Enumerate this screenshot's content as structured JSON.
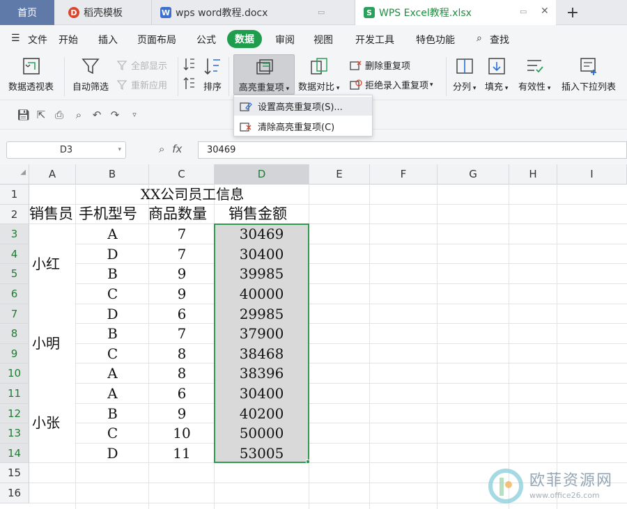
{
  "tabs": [
    {
      "label": "首页"
    },
    {
      "label": "稻壳模板"
    },
    {
      "label": "wps word教程.docx"
    },
    {
      "label": "WPS Excel教程.xlsx"
    }
  ],
  "tab_add": "+",
  "menu": [
    "文件",
    "开始",
    "插入",
    "页面布局",
    "公式",
    "数据",
    "审阅",
    "视图",
    "开发工具",
    "特色功能",
    "查找"
  ],
  "ribbon": {
    "pivot": "数据透视表",
    "autofilter": "自动筛选",
    "show_all": "全部显示",
    "reapply": "重新应用",
    "sort": "排序",
    "highlight_dup": "高亮重复项",
    "compare": "数据对比",
    "delete_dup": "删除重复项",
    "reject_dup": "拒绝录入重复项",
    "split": "分列",
    "fill": "填充",
    "validity": "有效性",
    "insert_dropdown": "插入下拉列表"
  },
  "dropdown": {
    "set": "设置高亮重复项(S)...",
    "clear": "清除高亮重复项(C)"
  },
  "formula": {
    "name_box": "D3",
    "fx": "fx",
    "value": "30469"
  },
  "columns": [
    "A",
    "B",
    "C",
    "D",
    "E",
    "F",
    "G",
    "H",
    "I"
  ],
  "rows": [
    "1",
    "2",
    "3",
    "4",
    "5",
    "6",
    "7",
    "8",
    "9",
    "10",
    "11",
    "12",
    "13",
    "14",
    "15",
    "16"
  ],
  "sheet": {
    "title": "XX公司员工信息",
    "headers": [
      "销售员",
      "手机型号",
      "商品数量",
      "销售金额"
    ],
    "groups": [
      "小红",
      "小明",
      "小张"
    ],
    "models": [
      "A",
      "D",
      "B",
      "C",
      "D",
      "B",
      "C",
      "A",
      "A",
      "B",
      "C",
      "D"
    ],
    "quantities": [
      "7",
      "7",
      "9",
      "9",
      "6",
      "7",
      "8",
      "8",
      "6",
      "9",
      "10",
      "11"
    ],
    "amounts": [
      "30469",
      "30400",
      "39985",
      "40000",
      "29985",
      "37900",
      "38468",
      "38396",
      "30400",
      "40200",
      "50000",
      "53005"
    ]
  },
  "watermark": {
    "title": "欧菲资源网",
    "url": "www.office26.com"
  },
  "colors": {
    "accent": "#1e9d4c",
    "selection_border": "#2f9a4f",
    "home_tab": "#5f7aa8"
  }
}
